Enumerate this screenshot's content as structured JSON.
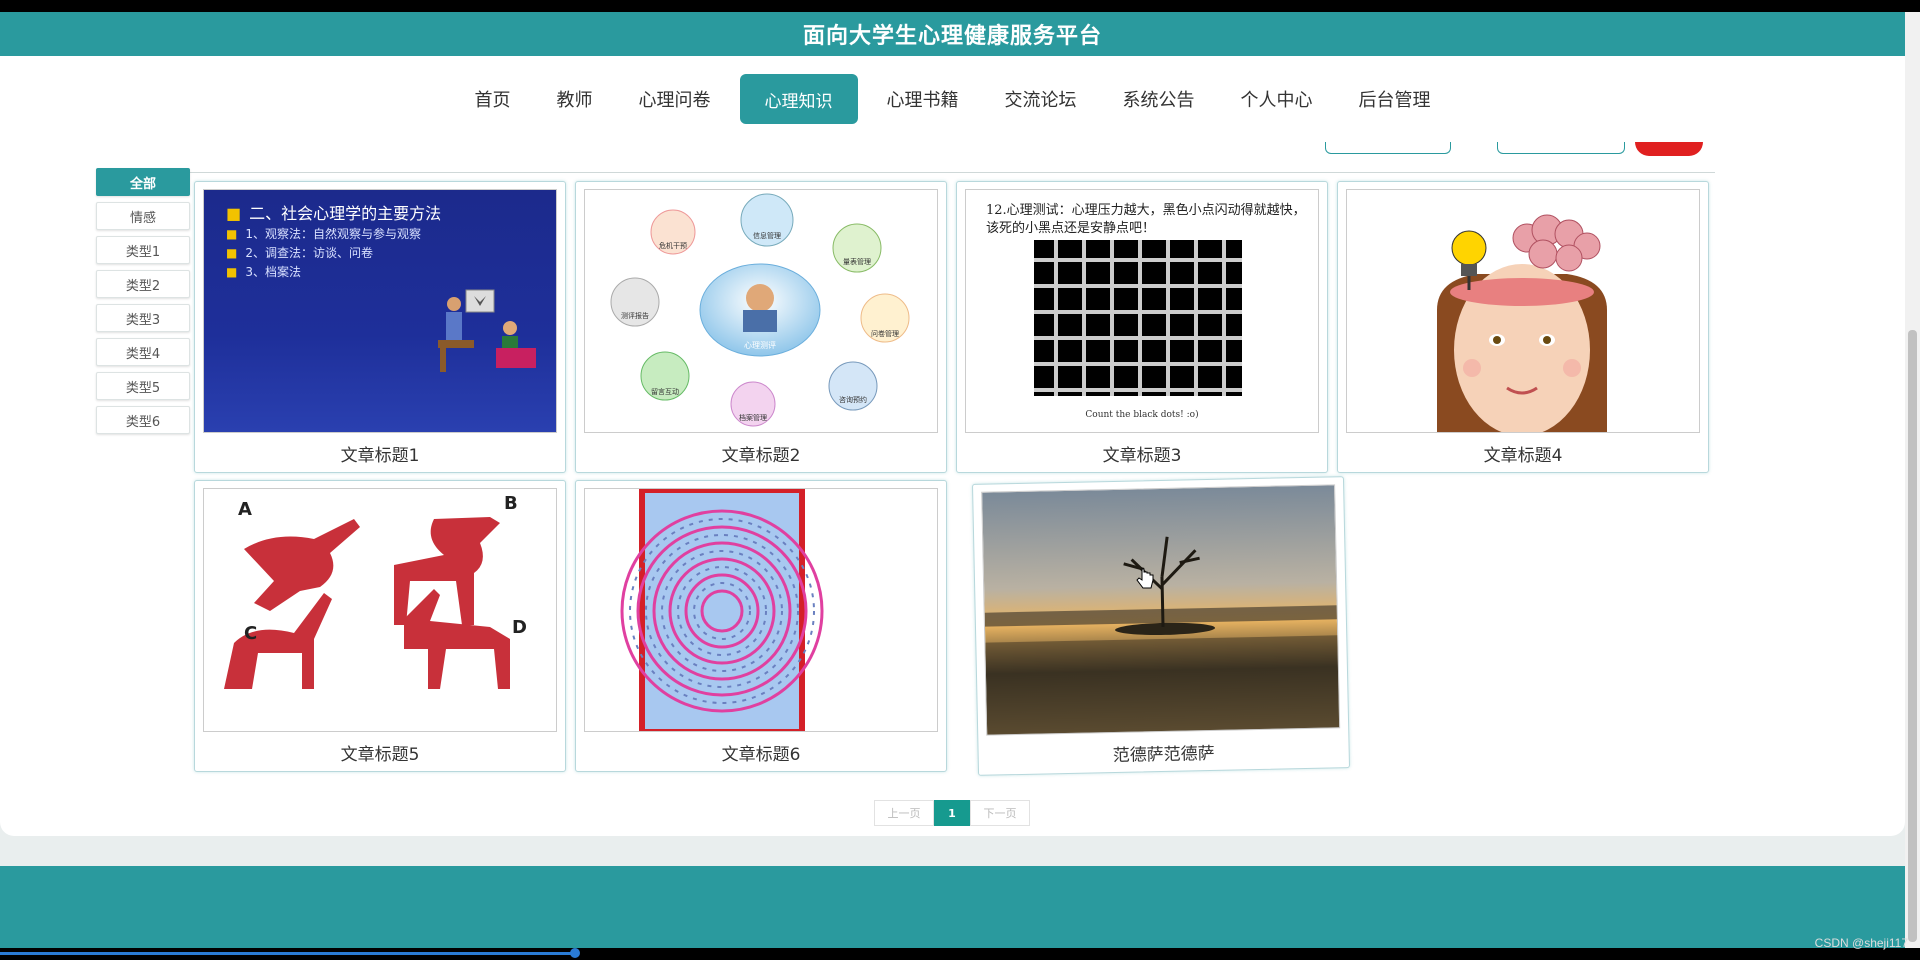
{
  "header": {
    "title": "面向大学生心理健康服务平台"
  },
  "nav": {
    "items": [
      "首页",
      "教师",
      "心理问卷",
      "心理知识",
      "心理书籍",
      "交流论坛",
      "系统公告",
      "个人中心",
      "后台管理"
    ],
    "active": "心理知识"
  },
  "sidebar": {
    "items": [
      "全部",
      "情感",
      "类型1",
      "类型2",
      "类型3",
      "类型4",
      "类型5",
      "类型6"
    ],
    "active": "全部"
  },
  "articles": [
    {
      "title": "文章标题1",
      "image": "ppt-slide-psychology-methods"
    },
    {
      "title": "文章标题2",
      "image": "system-diagram"
    },
    {
      "title": "文章标题3",
      "image": "grid-illusion"
    },
    {
      "title": "文章标题4",
      "image": "girl-brain-lightbulb"
    },
    {
      "title": "文章标题5",
      "image": "four-deer"
    },
    {
      "title": "文章标题6",
      "image": "spiral-illusion"
    },
    {
      "title": "范德萨范德萨",
      "image": "lake-tree-sunset"
    }
  ],
  "thumb1": {
    "heading": "二、社会心理学的主要方法",
    "lines": [
      "1、观察法：自然观察与参与观察",
      "2、调查法：访谈、问卷",
      "3、档案法"
    ]
  },
  "thumb2": {
    "center": "心理测评",
    "nodes": [
      "信息管理",
      "危机干预",
      "测评报告",
      "档案管理",
      "咨询预约",
      "问卷管理",
      "量表管理",
      "留言互动"
    ]
  },
  "thumb3": {
    "caption_top": "12.心理测试：心理压力越大，黑色小点闪动得就越快，该死的小黑点还是安静点吧！",
    "caption_bottom": "Count the black dots! :o)"
  },
  "thumb5": {
    "labels": [
      "A",
      "B",
      "C",
      "D"
    ]
  },
  "pager": {
    "prev": "上一页",
    "current": "1",
    "next": "下一页"
  },
  "watermark": "CSDN @sheji117",
  "colors": {
    "primary": "#2a9a9e",
    "pager_active": "#169a8f",
    "search_button": "#e02020"
  }
}
